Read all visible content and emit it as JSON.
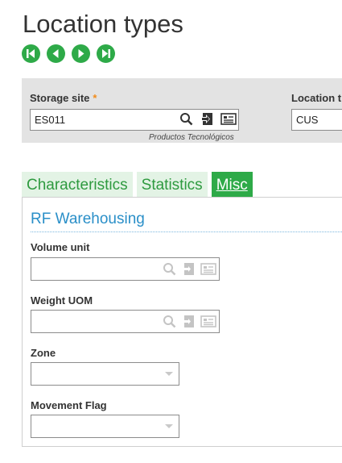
{
  "page": {
    "title": "Location types"
  },
  "nav": [
    "first-record",
    "previous-record",
    "next-record",
    "last-record"
  ],
  "criteria": {
    "storage_site": {
      "label": "Storage site",
      "required_mark": "*",
      "value": "ES011",
      "description": "Productos Tecnológicos"
    },
    "location_type": {
      "label": "Location t",
      "value": "CUS"
    }
  },
  "tabs": [
    {
      "label": "Characteristics",
      "active": false
    },
    {
      "label": "Statistics",
      "active": false
    },
    {
      "label": "Misc",
      "active": true
    }
  ],
  "section": {
    "title": "RF Warehousing"
  },
  "fields": {
    "volume_unit": {
      "label": "Volume unit",
      "value": ""
    },
    "weight_uom": {
      "label": "Weight UOM",
      "value": ""
    },
    "zone": {
      "label": "Zone",
      "value": ""
    },
    "movement_flag": {
      "label": "Movement Flag",
      "value": ""
    }
  },
  "colors": {
    "accent": "#2eaa48",
    "section": "#2a8fc8",
    "required": "#f28c1b"
  }
}
